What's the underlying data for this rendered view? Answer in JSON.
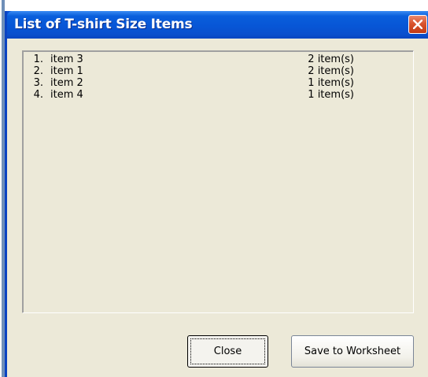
{
  "window": {
    "title": "List of T-shirt Size Items"
  },
  "icons": {
    "close": "close-icon"
  },
  "list": {
    "items": [
      {
        "num": "1.",
        "name": "item 3",
        "count": "2 item(s)"
      },
      {
        "num": "2.",
        "name": "item 1",
        "count": "2 item(s)"
      },
      {
        "num": "3.",
        "name": "item 2",
        "count": "1 item(s)"
      },
      {
        "num": "4.",
        "name": "item 4",
        "count": "1 item(s)"
      }
    ]
  },
  "buttons": {
    "close_label": "Close",
    "save_label": "Save to Worksheet"
  },
  "colors": {
    "titlebar": "#0756d6",
    "client": "#ece9d8",
    "close_button": "#d9542e"
  }
}
